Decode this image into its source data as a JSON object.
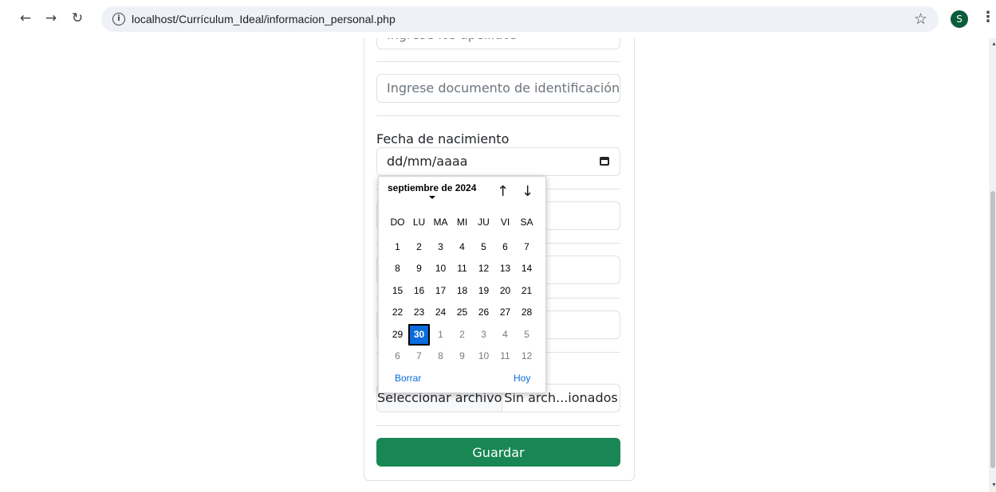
{
  "browser": {
    "url": "localhost/Currículum_Ideal/informacion_personal.php",
    "avatar_letter": "S"
  },
  "form": {
    "apellidos_placeholder": "Ingrese los apellidos",
    "documento_placeholder": "Ingrese documento de identificación",
    "fecha_label": "Fecha de nacimiento",
    "fecha_placeholder": "dd/mm/aaaa",
    "file_button": "Seleccionar archivo",
    "file_status": "Sin arch...ionados",
    "save_button": "Guardar"
  },
  "calendar": {
    "month_label": "septiembre de 2024",
    "weekdays": [
      "DO",
      "LU",
      "MA",
      "MI",
      "JU",
      "VI",
      "SA"
    ],
    "weeks": [
      [
        {
          "d": "1"
        },
        {
          "d": "2"
        },
        {
          "d": "3"
        },
        {
          "d": "4"
        },
        {
          "d": "5"
        },
        {
          "d": "6"
        },
        {
          "d": "7"
        }
      ],
      [
        {
          "d": "8"
        },
        {
          "d": "9"
        },
        {
          "d": "10"
        },
        {
          "d": "11"
        },
        {
          "d": "12"
        },
        {
          "d": "13"
        },
        {
          "d": "14"
        }
      ],
      [
        {
          "d": "15"
        },
        {
          "d": "16"
        },
        {
          "d": "17"
        },
        {
          "d": "18"
        },
        {
          "d": "19"
        },
        {
          "d": "20"
        },
        {
          "d": "21"
        }
      ],
      [
        {
          "d": "22"
        },
        {
          "d": "23"
        },
        {
          "d": "24"
        },
        {
          "d": "25"
        },
        {
          "d": "26"
        },
        {
          "d": "27"
        },
        {
          "d": "28"
        }
      ],
      [
        {
          "d": "29"
        },
        {
          "d": "30",
          "selected": true
        },
        {
          "d": "1",
          "other": true
        },
        {
          "d": "2",
          "other": true
        },
        {
          "d": "3",
          "other": true
        },
        {
          "d": "4",
          "other": true
        },
        {
          "d": "5",
          "other": true
        }
      ],
      [
        {
          "d": "6",
          "other": true
        },
        {
          "d": "7",
          "other": true
        },
        {
          "d": "8",
          "other": true
        },
        {
          "d": "9",
          "other": true
        },
        {
          "d": "10",
          "other": true
        },
        {
          "d": "11",
          "other": true
        },
        {
          "d": "12",
          "other": true
        }
      ]
    ],
    "clear_label": "Borrar",
    "today_label": "Hoy"
  },
  "colors": {
    "primary_green": "#198754",
    "calendar_selected": "#0a6cdd"
  }
}
